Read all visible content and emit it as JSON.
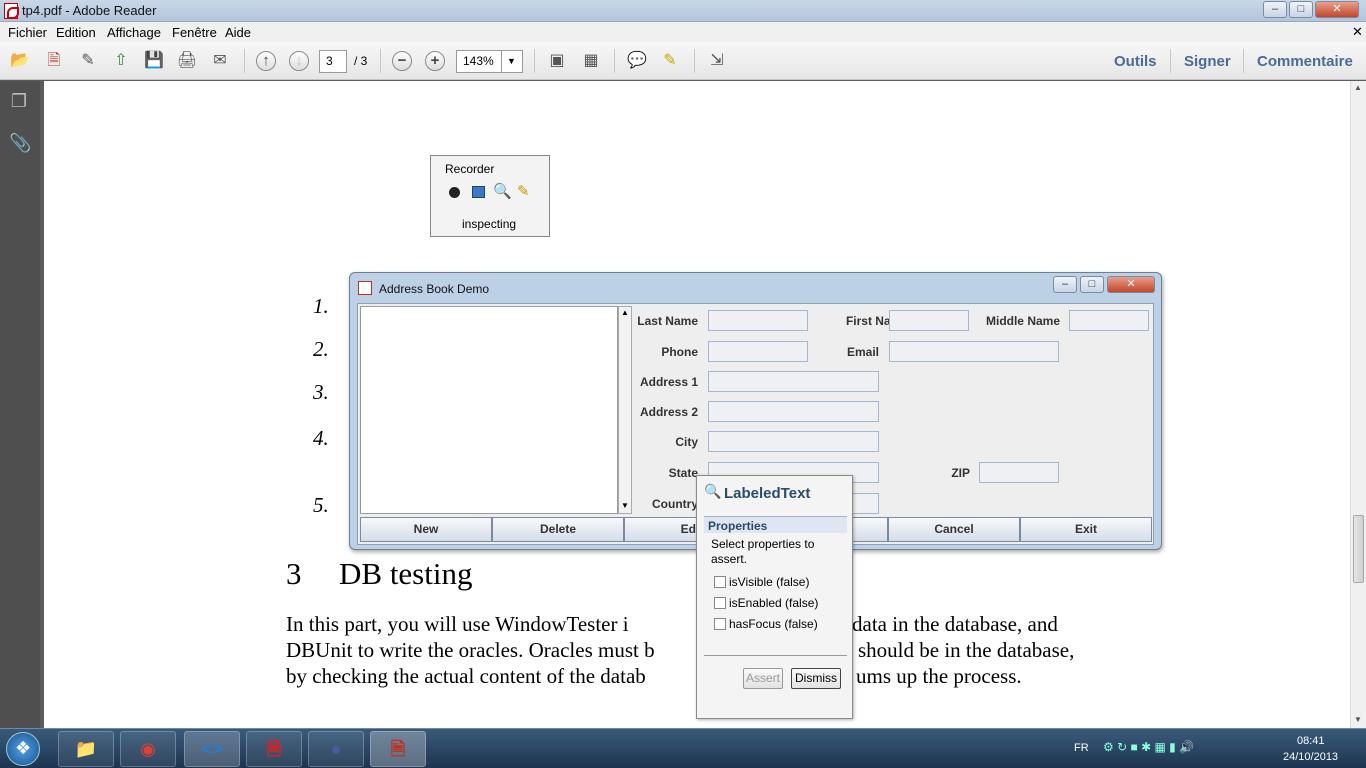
{
  "window": {
    "title": "tp4.pdf - Adobe Reader"
  },
  "menu": [
    "Fichier",
    "Edition",
    "Affichage",
    "Fenêtre",
    "Aide"
  ],
  "toolbar": {
    "page_current": "3",
    "page_total": "/ 3",
    "zoom": "143%",
    "outils": "Outils",
    "signer": "Signer",
    "commentaire": "Commentaire"
  },
  "recorder": {
    "title": "Recorder",
    "status": "inspecting"
  },
  "document": {
    "list_numbers": [
      "1.",
      "2.",
      "3.",
      "4.",
      "5."
    ],
    "section_number": "3",
    "section_title": "DB testing",
    "para_line1_a": "In this part, you will use WindowTester i",
    "para_line1_b": "data in the database, and",
    "para_line2_a": "DBUnit to write the oracles. Oracles must b",
    "para_line2_b": "should be in the database,",
    "para_line3_a": "by checking the actual content of the datab",
    "para_line3_b": "ums up the process."
  },
  "addressbook": {
    "title": "Address Book Demo",
    "labels": {
      "last_name": "Last Name",
      "first_name": "First Name",
      "middle_name": "Middle Name",
      "phone": "Phone",
      "email": "Email",
      "address1": "Address 1",
      "address2": "Address 2",
      "city": "City",
      "state": "State",
      "zip": "ZIP",
      "country": "Country"
    },
    "buttons": {
      "new": "New",
      "delete": "Delete",
      "edit": "Edi",
      "cancel": "Cancel",
      "exit": "Exit"
    }
  },
  "popup": {
    "title": "LabeledText",
    "section": "Properties",
    "desc": "Select properties to assert.",
    "props": [
      "isVisible (false)",
      "isEnabled (false)",
      "hasFocus (false)"
    ],
    "assert": "Assert",
    "dismiss": "Dismiss"
  },
  "tray": {
    "lang": "FR",
    "time": "08:41",
    "date": "24/10/2013"
  }
}
